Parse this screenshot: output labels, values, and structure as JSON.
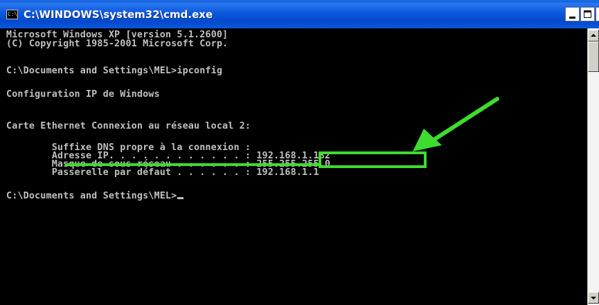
{
  "window": {
    "title": "C:\\WINDOWS\\system32\\cmd.exe",
    "icon": "cmd-icon",
    "icon_text": "C:\\"
  },
  "console": {
    "lines": [
      "Microsoft Windows XP [version 5.1.2600]",
      "(C) Copyright 1985-2001 Microsoft Corp.",
      "C:\\Documents and Settings\\MEL>ipconfig",
      "Configuration IP de Windows",
      "Carte Ethernet Connexion au réseau local 2:",
      "        Suffixe DNS propre à la connexion :",
      "        Adresse IP. . . . . . . . . . . . : 192.168.1.182",
      "        Masque de sous-réseau . . . . . . : 255.255.255.0",
      "        Passerelle par défaut . . . . . . : 192.168.1.1",
      "C:\\Documents and Settings\\MEL>"
    ]
  },
  "annotation": {
    "color": "#3ddc2e",
    "highlight_value": "192.168.1.182"
  },
  "colors": {
    "console_bg": "#000000",
    "console_text": "#c0c0c0",
    "titlebar": "#0a58dc"
  }
}
